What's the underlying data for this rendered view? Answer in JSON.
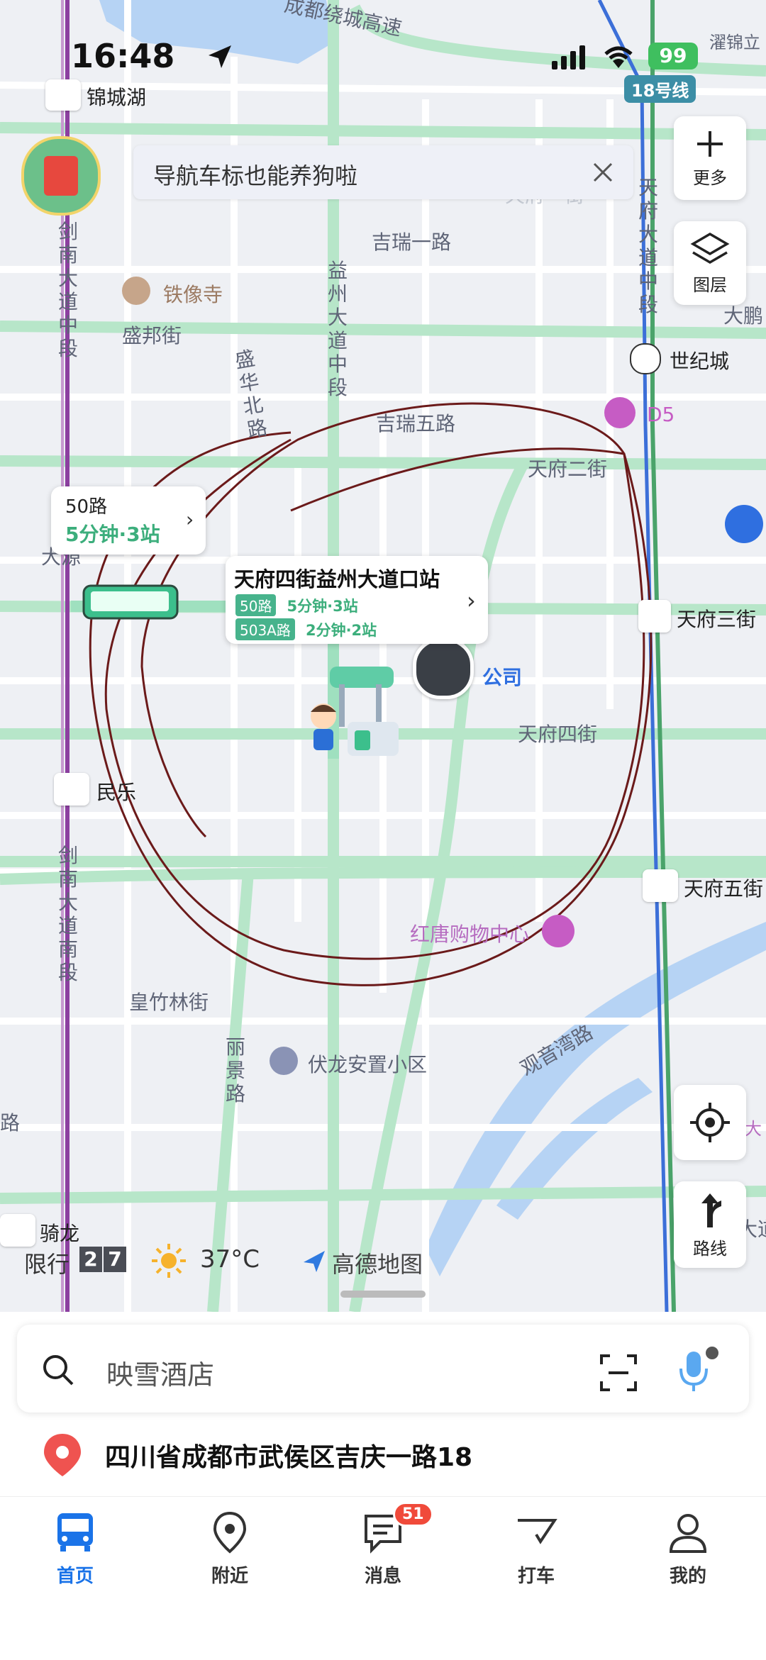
{
  "status_bar": {
    "time": "16:48",
    "battery": "99"
  },
  "map_labels": {
    "ring_highway": "成都绕城高速",
    "metro_line": "18号线",
    "lake": "锦城湖",
    "top_right": "濯锦立",
    "tianfu_yijie": "天府一街",
    "jianan_mid": "剑南大道中段",
    "jianan_south": "剑南大道南段",
    "jirui_1": "吉瑞一路",
    "yizhou_mid": "益州大道中段",
    "tianfu_dadao": "天府大道中段",
    "tiexiang": "铁像寺",
    "shengbang": "盛邦街",
    "shenghua": "盛华北路",
    "dapeng": "大鹏",
    "shijicheng": "世纪城",
    "jirui_5": "吉瑞五路",
    "d5": "D5",
    "tianfu_2": "天府二街",
    "dayuan": "大源",
    "tianfu_3": "天府三街",
    "company": "公司",
    "tianfu_4": "天府四街",
    "minle": "民乐",
    "tianfu_5": "天府五街",
    "hongtang": "红唐购物中心",
    "huangzhulin": "皇竹林街",
    "guanyinwan": "观音湾路",
    "lijing": "丽景路",
    "fulong": "伏龙安置小区",
    "lu_left": "路",
    "qilong": "骑龙",
    "da_right": "大",
    "da_right2": "大道"
  },
  "banner": {
    "text": "导航车标也能养狗啦"
  },
  "side_buttons": {
    "more": "更多",
    "layers": "图层",
    "route": "路线"
  },
  "bus_popup": {
    "route": "50路",
    "eta": "5分钟·3站"
  },
  "stop_popup": {
    "name": "天府四街益州大道口站",
    "lines": [
      {
        "route": "50路",
        "eta": "5分钟·3站"
      },
      {
        "route": "503A路",
        "eta": "2分钟·2站"
      }
    ]
  },
  "restriction": {
    "label": "限行",
    "digit1": "2",
    "digit2": "7"
  },
  "weather": {
    "temperature": "37°C"
  },
  "brand": {
    "name": "高德地图"
  },
  "search": {
    "placeholder": "映雪酒店"
  },
  "location": {
    "address": "四川省成都市武侯区吉庆一路18"
  },
  "tabs": [
    {
      "label": "首页",
      "active": true
    },
    {
      "label": "附近",
      "active": false
    },
    {
      "label": "消息",
      "badge": "51",
      "active": false
    },
    {
      "label": "打车",
      "active": false
    },
    {
      "label": "我的",
      "active": false
    }
  ],
  "colors": {
    "accent": "#1a73e8",
    "route_green": "#9fe0bf",
    "badge_red": "#f04a3a",
    "metro_purple": "#8c3fa0"
  }
}
